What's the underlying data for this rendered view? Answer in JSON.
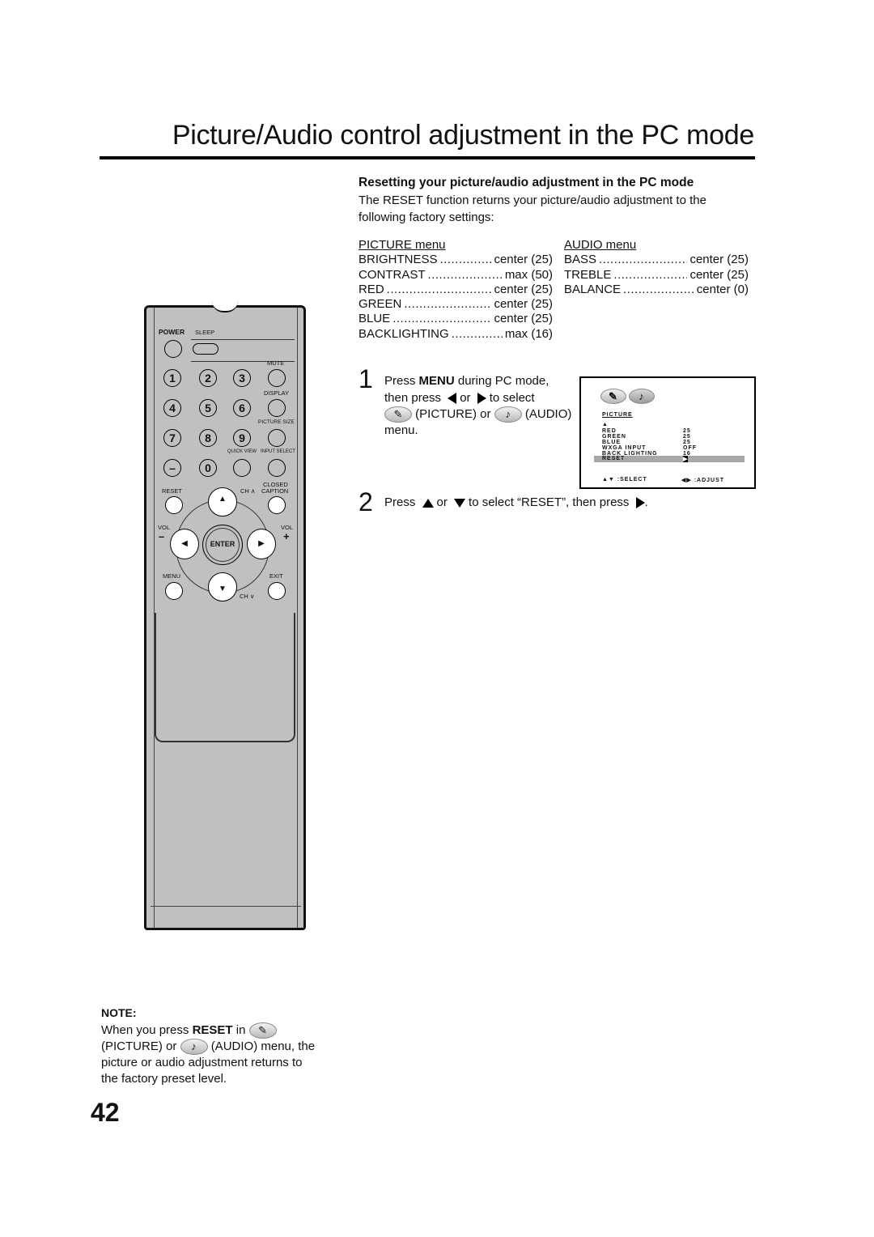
{
  "page": {
    "title": "Picture/Audio control adjustment in the PC mode",
    "number": "42"
  },
  "section": {
    "heading": "Resetting your picture/audio adjustment in the PC mode",
    "intro": "The RESET function returns your picture/audio adjustment to the following factory settings:"
  },
  "picture_menu": {
    "header": "PICTURE menu",
    "items": [
      {
        "name": "BRIGHTNESS",
        "value": "center (25)"
      },
      {
        "name": "CONTRAST",
        "value": "max (50)"
      },
      {
        "name": "RED",
        "value": "center (25)"
      },
      {
        "name": "GREEN",
        "value": "center (25)"
      },
      {
        "name": "BLUE",
        "value": "center (25)"
      },
      {
        "name": "BACKLIGHTING",
        "value": "max (16)"
      }
    ]
  },
  "audio_menu": {
    "header": "AUDIO menu",
    "items": [
      {
        "name": "BASS",
        "value": "center (25)"
      },
      {
        "name": "TREBLE",
        "value": "center (25)"
      },
      {
        "name": "BALANCE",
        "value": "center (0)"
      }
    ]
  },
  "steps": {
    "step1": {
      "number": "1",
      "t1": "Press ",
      "bold": "MENU",
      "t2": " during PC mode,",
      "t3": "then press",
      "t4": "or",
      "t5": "to select",
      "t6": "(PICTURE) or",
      "t7": "(AUDIO)",
      "t8": "menu."
    },
    "step2": {
      "number": "2",
      "t1": "Press",
      "t2": "or",
      "t3": "to select “RESET”, then press",
      "t4": "."
    }
  },
  "osd": {
    "title": "PICTURE",
    "scroll_up": "▲",
    "rows": [
      {
        "name": "RED",
        "value": "25"
      },
      {
        "name": "GREEN",
        "value": "25"
      },
      {
        "name": "BLUE",
        "value": "25"
      },
      {
        "name": "WXGA INPUT",
        "value": "OFF"
      },
      {
        "name": "BACK LIGHTING",
        "value": "16"
      },
      {
        "name": "RESET",
        "value": "▶",
        "selected": true
      }
    ],
    "footer_select": "▲▼ :SELECT",
    "footer_adjust": "◀▶ :ADJUST"
  },
  "remote": {
    "labels": {
      "power": "POWER",
      "sleep": "SLEEP",
      "mute": "MUTE",
      "display": "DISPLAY",
      "picture_size": "PICTURE SIZE",
      "quick_view": "QUICK VIEW",
      "input_select": "INPUT SELECT",
      "reset": "RESET",
      "ch_up": "CH ∧",
      "closed": "CLOSED",
      "caption": "CAPTION",
      "vol_left": "VOL",
      "vol_minus": "–",
      "vol_right": "VOL",
      "vol_plus": "+",
      "enter": "ENTER",
      "menu": "MENU",
      "exit": "EXIT",
      "ch_down": "CH ∨"
    },
    "digits": [
      "1",
      "2",
      "3",
      "4",
      "5",
      "6",
      "7",
      "8",
      "9",
      "–",
      "0"
    ]
  },
  "note": {
    "heading": "NOTE:",
    "t1": "When you press ",
    "bold": "RESET",
    "t2": " in",
    "t3": "(PICTURE) or",
    "t4": "(AUDIO) menu,",
    "t5": "the picture or audio adjustment returns to the factory preset level."
  }
}
